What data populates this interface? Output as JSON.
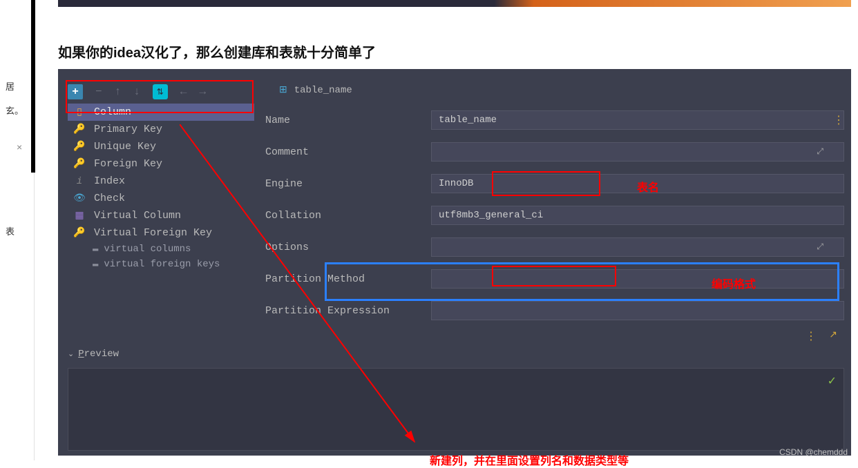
{
  "left_sidebar": {
    "text1": "居",
    "text2": "玄。",
    "text3": "表"
  },
  "heading": "如果你的idea汉化了，那么创建库和表就十分简单了",
  "tab": {
    "title": "table_name"
  },
  "sidebar": {
    "items": [
      {
        "label": "Column"
      },
      {
        "label": "Primary Key"
      },
      {
        "label": "Unique Key"
      },
      {
        "label": "Foreign Key"
      },
      {
        "label": "Index"
      },
      {
        "label": "Check"
      },
      {
        "label": "Virtual Column"
      },
      {
        "label": "Virtual Foreign Key"
      }
    ],
    "sub_items": [
      {
        "label": "virtual columns"
      },
      {
        "label": "virtual foreign keys"
      }
    ]
  },
  "form": {
    "name_label": "Name",
    "name_value": "table_name",
    "comment_label": "Comment",
    "comment_value": "",
    "engine_label": "Engine",
    "engine_value": "InnoDB",
    "collation_label": "Collation",
    "collation_value": "utf8mb3_general_ci",
    "options_label": "Options",
    "options_value": "",
    "partition_method_label": "Partition Method",
    "partition_method_value": "",
    "partition_expr_label": "Partition Expression",
    "partition_expr_value": ""
  },
  "preview": {
    "label": "Preview"
  },
  "annotations": {
    "table_name": "表名",
    "encoding": "编码格式",
    "new_column": "新建列，并在里面设置列名和数据类型等"
  },
  "watermark": "CSDN @chemddd"
}
